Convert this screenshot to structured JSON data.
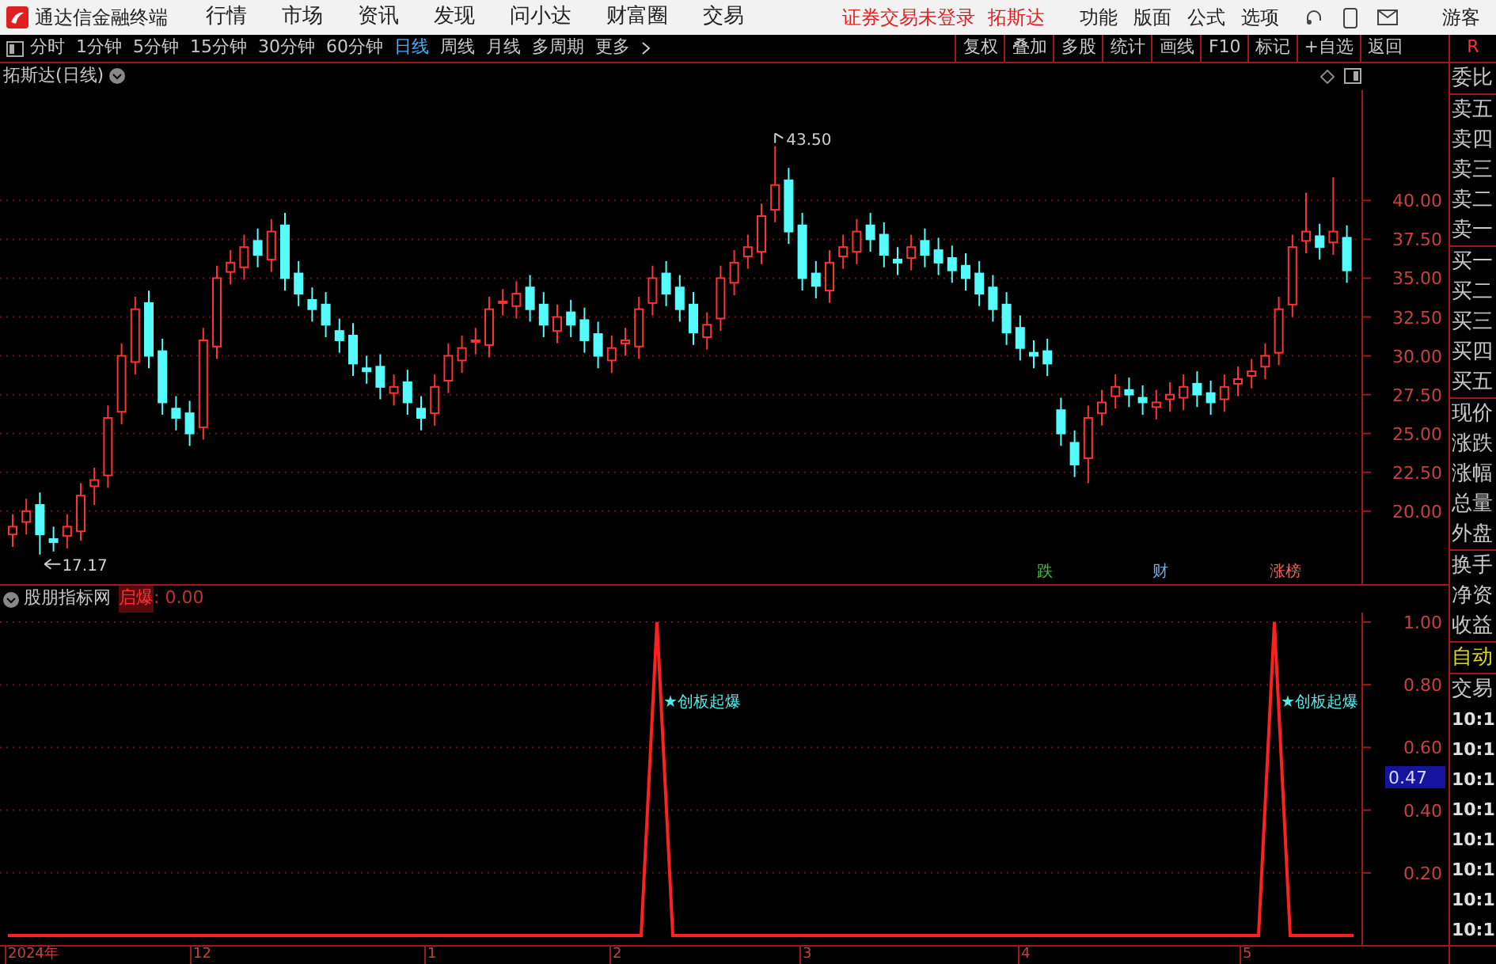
{
  "app": {
    "title": "通达信金融终端"
  },
  "menu": [
    "行情",
    "市场",
    "资讯",
    "发现",
    "问小达",
    "财富圈",
    "交易"
  ],
  "login_status": "证券交易未登录",
  "stock_link": "拓斯达",
  "right_menu": [
    "功能",
    "版面",
    "公式",
    "选项"
  ],
  "user": "游客",
  "periods": [
    {
      "label": "分时",
      "selected": false
    },
    {
      "label": "1分钟",
      "selected": false
    },
    {
      "label": "5分钟",
      "selected": false
    },
    {
      "label": "15分钟",
      "selected": false
    },
    {
      "label": "30分钟",
      "selected": false
    },
    {
      "label": "60分钟",
      "selected": false
    },
    {
      "label": "日线",
      "selected": true
    },
    {
      "label": "周线",
      "selected": false
    },
    {
      "label": "月线",
      "selected": false
    },
    {
      "label": "多周期",
      "selected": false
    },
    {
      "label": "更多",
      "selected": false
    }
  ],
  "tools": [
    "复权",
    "叠加",
    "多股",
    "统计",
    "画线",
    "F10",
    "标记",
    "+自选",
    "返回"
  ],
  "toolbar_tail": "R",
  "price_chart": {
    "title": "拓斯达(日线)",
    "chart_data": {
      "type": "candlestick",
      "grid": true,
      "ylim": [
        15.2,
        47.1
      ],
      "yticks": [
        {
          "value": 40,
          "label": "40.00"
        },
        {
          "value": 37.5,
          "label": "37.50"
        },
        {
          "value": 35,
          "label": "35.00"
        },
        {
          "value": 32.5,
          "label": "32.50"
        },
        {
          "value": 30,
          "label": "30.00"
        },
        {
          "value": 27.5,
          "label": "27.50"
        },
        {
          "value": 25,
          "label": "25.00"
        },
        {
          "value": 22.5,
          "label": "22.50"
        },
        {
          "value": 20,
          "label": "20.00"
        }
      ],
      "ohlc": [
        [
          18.5,
          19.8,
          17.7,
          19
        ],
        [
          19.3,
          20.8,
          18.5,
          20
        ],
        [
          20.4,
          21.2,
          17.2,
          18.5
        ],
        [
          18.2,
          19,
          17.4,
          18
        ],
        [
          18.4,
          19.8,
          17.6,
          19
        ],
        [
          18.7,
          21.8,
          18.1,
          21
        ],
        [
          21.6,
          22.8,
          20.4,
          22
        ],
        [
          22.3,
          26.8,
          21.5,
          26
        ],
        [
          26.4,
          30.8,
          25.6,
          30
        ],
        [
          29.6,
          33.8,
          28.8,
          33
        ],
        [
          33.4,
          34.2,
          29.2,
          30
        ],
        [
          30.3,
          31.1,
          26.2,
          27
        ],
        [
          26.6,
          27.4,
          25.2,
          26
        ],
        [
          26.3,
          27.1,
          24.2,
          25
        ],
        [
          25.4,
          31.8,
          24.6,
          31
        ],
        [
          30.6,
          35.8,
          29.8,
          35
        ],
        [
          35.4,
          36.8,
          34.6,
          36
        ],
        [
          35.7,
          37.8,
          34.9,
          37
        ],
        [
          37.4,
          38.2,
          35.7,
          36.5
        ],
        [
          36.2,
          38.8,
          35.4,
          38
        ],
        [
          38.4,
          39.2,
          34.2,
          35
        ],
        [
          35.3,
          36.1,
          33.2,
          34
        ],
        [
          33.6,
          34.4,
          32.2,
          33
        ],
        [
          33.3,
          34.1,
          31.2,
          32
        ],
        [
          31.6,
          32.4,
          30.2,
          31
        ],
        [
          31.3,
          32.1,
          28.7,
          29.5
        ],
        [
          29.2,
          30,
          28.2,
          29
        ],
        [
          29.3,
          30.1,
          27.2,
          28
        ],
        [
          27.6,
          28.8,
          26.8,
          28
        ],
        [
          28.3,
          29.1,
          26.2,
          27
        ],
        [
          26.6,
          27.4,
          25.2,
          26
        ],
        [
          26.3,
          28.8,
          25.5,
          28
        ],
        [
          28.4,
          30.8,
          27.6,
          30
        ],
        [
          29.7,
          31.3,
          28.9,
          30.5
        ],
        [
          30.9,
          31.8,
          30.1,
          31
        ],
        [
          30.7,
          33.8,
          29.9,
          33
        ],
        [
          33.4,
          34.3,
          32.6,
          33.5
        ],
        [
          33.2,
          34.8,
          32.4,
          34
        ],
        [
          34.4,
          35.2,
          32.2,
          33
        ],
        [
          33.3,
          34.1,
          31.2,
          32
        ],
        [
          31.6,
          33.3,
          30.8,
          32.5
        ],
        [
          32.8,
          33.6,
          31.2,
          32
        ],
        [
          32.3,
          33.1,
          30.2,
          31
        ],
        [
          31.4,
          32.2,
          29.2,
          30
        ],
        [
          29.7,
          31.3,
          28.9,
          30.5
        ],
        [
          30.8,
          31.8,
          30,
          31
        ],
        [
          30.6,
          33.8,
          29.8,
          33
        ],
        [
          33.4,
          35.8,
          32.6,
          35
        ],
        [
          35.3,
          36.1,
          33.2,
          34
        ],
        [
          34.4,
          35.2,
          32.2,
          33
        ],
        [
          33.3,
          34.1,
          30.7,
          31.5
        ],
        [
          31.2,
          32.8,
          30.4,
          32
        ],
        [
          32.4,
          35.8,
          31.6,
          35
        ],
        [
          34.7,
          36.8,
          33.9,
          36
        ],
        [
          36.4,
          37.8,
          35.6,
          37
        ],
        [
          36.7,
          39.8,
          35.9,
          39
        ],
        [
          39.4,
          43.5,
          38.6,
          41
        ],
        [
          41.3,
          42.1,
          37.2,
          38
        ],
        [
          38.4,
          39.2,
          34.2,
          35
        ],
        [
          35.3,
          36.1,
          33.7,
          34.5
        ],
        [
          34.2,
          36.8,
          33.4,
          36
        ],
        [
          36.4,
          37.8,
          35.6,
          37
        ],
        [
          36.7,
          38.8,
          35.9,
          38
        ],
        [
          38.4,
          39.2,
          36.7,
          37.5
        ],
        [
          37.8,
          38.6,
          35.7,
          36.5
        ],
        [
          36.2,
          37,
          35.2,
          36
        ],
        [
          36.3,
          37.8,
          35.5,
          37
        ],
        [
          37.4,
          38.2,
          35.7,
          36.5
        ],
        [
          36.8,
          37.6,
          35.2,
          36
        ],
        [
          36.3,
          37.1,
          34.7,
          35.5
        ],
        [
          35.8,
          36.6,
          34.2,
          35
        ],
        [
          35.3,
          36.1,
          33.2,
          34
        ],
        [
          34.4,
          35.2,
          32.2,
          33
        ],
        [
          33.3,
          34.1,
          30.7,
          31.5
        ],
        [
          31.8,
          32.6,
          29.7,
          30.5
        ],
        [
          30.2,
          31,
          29.2,
          30
        ],
        [
          30.3,
          31.1,
          28.7,
          29.5
        ],
        [
          26.5,
          27.3,
          24.2,
          25
        ],
        [
          24.4,
          25.2,
          22.2,
          23
        ],
        [
          23.4,
          26.8,
          21.8,
          26
        ],
        [
          26.3,
          27.8,
          25.5,
          27
        ],
        [
          27.4,
          28.8,
          26.6,
          28
        ],
        [
          27.8,
          28.6,
          26.7,
          27.5
        ],
        [
          27.3,
          28.1,
          26.2,
          27
        ],
        [
          26.7,
          27.8,
          25.9,
          27
        ],
        [
          27.2,
          28.3,
          26.4,
          27.5
        ],
        [
          27.3,
          28.8,
          26.5,
          28
        ],
        [
          28.2,
          29,
          26.7,
          27.5
        ],
        [
          27.6,
          28.4,
          26.2,
          27
        ],
        [
          27.2,
          28.8,
          26.4,
          28
        ],
        [
          28.2,
          29.3,
          27.4,
          28.5
        ],
        [
          28.7,
          29.8,
          27.9,
          29
        ],
        [
          29.3,
          30.8,
          28.5,
          30
        ],
        [
          30.2,
          33.8,
          29.4,
          33
        ],
        [
          33.3,
          37.8,
          32.5,
          37
        ],
        [
          37.4,
          40.5,
          36.6,
          38
        ],
        [
          37.7,
          38.5,
          36.2,
          37
        ],
        [
          37.3,
          41.5,
          36.5,
          38
        ],
        [
          37.6,
          38.4,
          34.7,
          35.5
        ]
      ],
      "annotations": [
        {
          "text": "43.50"
        },
        {
          "text": "17.17"
        }
      ]
    },
    "events": [
      {
        "label": "跌",
        "color": "#40c040"
      },
      {
        "label": "财",
        "color": "#70a8e8"
      },
      {
        "label": "涨榜",
        "color": "#e86060"
      }
    ]
  },
  "indicator": {
    "name": "股朋指标网",
    "value": ": 0.00",
    "cursor_value": "0.47",
    "chart_data": {
      "type": "line",
      "grid": true,
      "ylim": [
        -0.03,
        1.03
      ],
      "yticks": [
        {
          "value": 1,
          "label": "1.00"
        },
        {
          "value": 0.8,
          "label": "0.80"
        },
        {
          "value": 0.6,
          "label": "0.60"
        },
        {
          "value": 0.4,
          "label": "0.40"
        },
        {
          "value": 0.2,
          "label": "0.20"
        }
      ],
      "series": [
        {
          "name": "启爆",
          "color": "#ff2020",
          "values": [
            0,
            0,
            0,
            0,
            0,
            0,
            0,
            0,
            0,
            0,
            0,
            0,
            0,
            0,
            0,
            0,
            0,
            0,
            0,
            0,
            0,
            0,
            0,
            0,
            0,
            0,
            0,
            0,
            0,
            0,
            0,
            0,
            0,
            0,
            0,
            0,
            0,
            0,
            0,
            0,
            0,
            1,
            0,
            0,
            0,
            0,
            0,
            0,
            0,
            0,
            0,
            0,
            0,
            0,
            0,
            0,
            0,
            0,
            0,
            0,
            0,
            0,
            0,
            0,
            0,
            0,
            0,
            0,
            0,
            0,
            0,
            0,
            0,
            0,
            0,
            0,
            0,
            0,
            0,
            0,
            1,
            0,
            0,
            0,
            0,
            0
          ]
        }
      ],
      "annotations": [
        {
          "text": "★创板起爆"
        },
        {
          "text": "★创板起爆"
        }
      ]
    }
  },
  "date_axis": [
    "2024年",
    "12",
    "1",
    "2",
    "3",
    "4",
    "5"
  ],
  "quote_panel": {
    "groups": [
      {
        "items": [
          {
            "text": "委比",
            "kind": "plain"
          }
        ]
      },
      {
        "items": [
          {
            "text": "卖五",
            "kind": "plain"
          },
          {
            "text": "卖四",
            "kind": "plain"
          },
          {
            "text": "卖三",
            "kind": "plain"
          },
          {
            "text": "卖二",
            "kind": "plain"
          },
          {
            "text": "卖一",
            "kind": "plain"
          }
        ]
      },
      {
        "items": [
          {
            "text": "买一",
            "kind": "plain"
          },
          {
            "text": "买二",
            "kind": "plain"
          },
          {
            "text": "买三",
            "kind": "plain"
          },
          {
            "text": "买四",
            "kind": "plain"
          },
          {
            "text": "买五",
            "kind": "plain"
          }
        ]
      },
      {
        "items": [
          {
            "text": "现价",
            "kind": "plain"
          },
          {
            "text": "涨跌",
            "kind": "plain"
          },
          {
            "text": "涨幅",
            "kind": "plain"
          },
          {
            "text": "总量",
            "kind": "plain"
          },
          {
            "text": "外盘",
            "kind": "plain"
          }
        ]
      },
      {
        "items": [
          {
            "text": "换手",
            "kind": "plain"
          },
          {
            "text": "净资",
            "kind": "plain"
          },
          {
            "text": "收益",
            "kind": "plain"
          }
        ]
      },
      {
        "items": [
          {
            "text": "自动",
            "kind": "accent"
          }
        ]
      },
      {
        "items": [
          {
            "text": "交易",
            "kind": "plain"
          },
          {
            "text": "10:1",
            "kind": "time"
          },
          {
            "text": "10:1",
            "kind": "time"
          },
          {
            "text": "10:1",
            "kind": "time"
          },
          {
            "text": "10:1",
            "kind": "time"
          },
          {
            "text": "10:1",
            "kind": "time"
          },
          {
            "text": "10:1",
            "kind": "time"
          },
          {
            "text": "10:1",
            "kind": "time"
          },
          {
            "text": "10:1",
            "kind": "time"
          }
        ]
      }
    ]
  }
}
